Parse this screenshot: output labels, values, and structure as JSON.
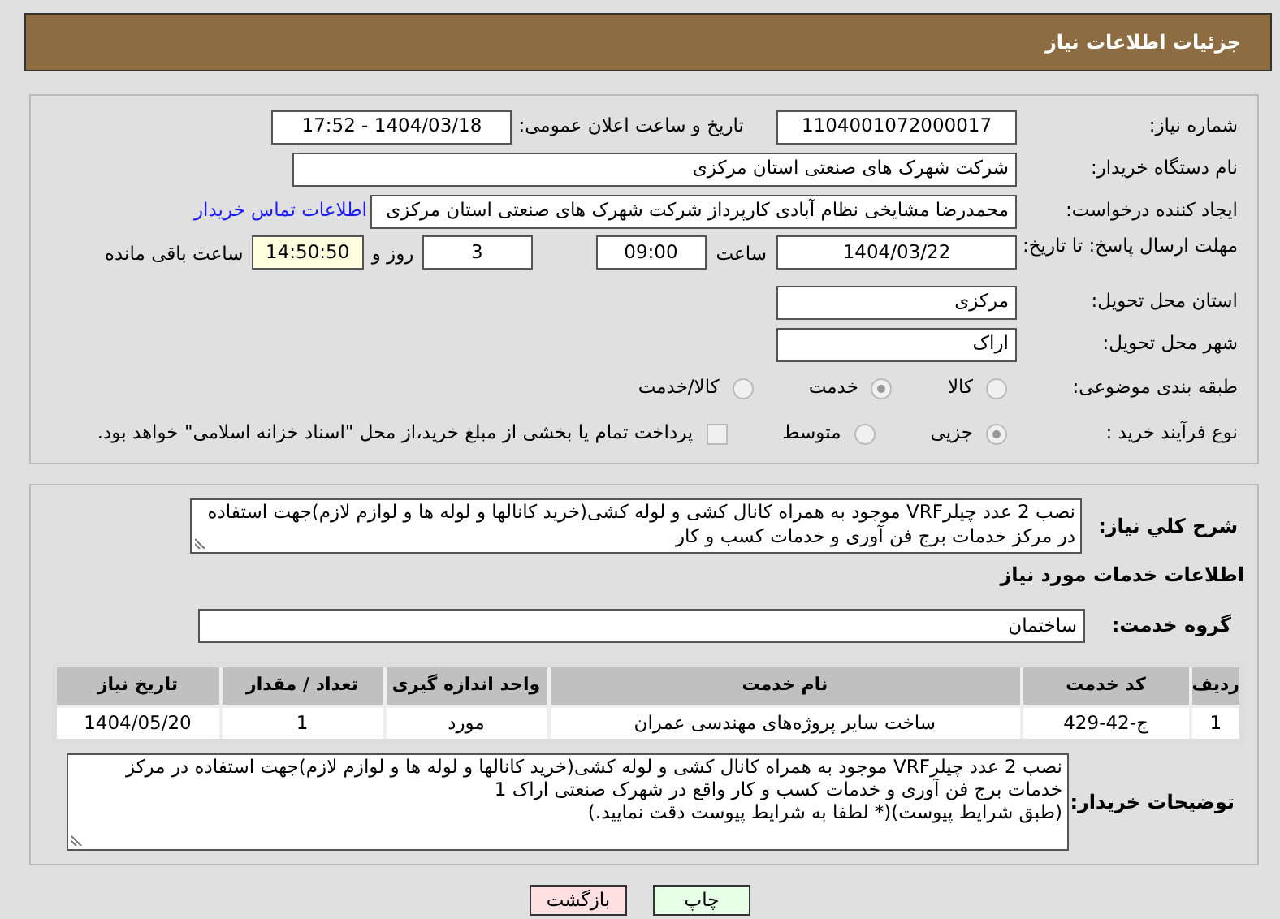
{
  "header": {
    "title": "جزئیات اطلاعات نیاز"
  },
  "need_number": {
    "label": "شماره نیاز:",
    "value": "1104001072000017"
  },
  "announce_datetime": {
    "label": "تاریخ و ساعت اعلان عمومی:",
    "value": "1404/03/18 - 17:52"
  },
  "buyer_org": {
    "label": "نام دستگاه خریدار:",
    "value": "شرکت شهرک های صنعتی استان مرکزی"
  },
  "requester": {
    "label": "ایجاد کننده درخواست:",
    "value": "محمدرضا مشایخی نظام آبادی کارپرداز شرکت شهرک های صنعتی استان مرکزی",
    "link": "اطلاعات تماس خریدار"
  },
  "deadline": {
    "label": "مهلت ارسال پاسخ: تا تاریخ:",
    "date": "1404/03/22",
    "time_label": "ساعت",
    "time": "09:00",
    "days": "3",
    "days_label": "روز و",
    "remaining": "14:50:50",
    "remaining_label": "ساعت باقی مانده"
  },
  "province": {
    "label": "استان محل تحویل:",
    "value": "مرکزی"
  },
  "city": {
    "label": "شهر محل تحویل:",
    "value": "اراک"
  },
  "category": {
    "label": "طبقه بندی موضوعی:",
    "options": [
      {
        "label": "کالا",
        "selected": false
      },
      {
        "label": "خدمت",
        "selected": true
      },
      {
        "label": "کالا/خدمت",
        "selected": false
      }
    ]
  },
  "purchase_type": {
    "label": "نوع فرآیند خرید :",
    "options": [
      {
        "label": "جزیی",
        "selected": true
      },
      {
        "label": "متوسط",
        "selected": false
      }
    ],
    "treasury": {
      "checked": false,
      "text": "پرداخت تمام یا بخشی از مبلغ خرید،از محل \"اسناد خزانه اسلامی\" خواهد بود."
    }
  },
  "summary": {
    "label": "شرح کلي نياز:",
    "value": "نصب 2 عدد چیلرVRF موجود به همراه کانال کشی و لوله کشی(خرید کانالها و لوله ها و لوازم لازم)جهت استفاده در مرکز خدمات برج فن آوری و خدمات کسب و کار"
  },
  "services_heading": "اطلاعات خدمات مورد نیاز",
  "service_group": {
    "label": "گروه خدمت:",
    "value": "ساختمان"
  },
  "table": {
    "columns": [
      "ردیف",
      "کد خدمت",
      "نام خدمت",
      "واحد اندازه گیری",
      "تعداد / مقدار",
      "تاریخ نیاز"
    ],
    "rows": [
      [
        "1",
        "ج-42-429",
        "ساخت سایر پروژه‌های مهندسی عمران",
        "مورد",
        "1",
        "1404/05/20"
      ]
    ]
  },
  "buyer_notes": {
    "label": "توضیحات خریدار:",
    "value": "نصب 2 عدد چیلرVRF موجود به همراه کانال کشی و لوله کشی(خرید کانالها و لوله ها و لوازم لازم)جهت استفاده در مرکز خدمات برج فن آوری و خدمات کسب و کار واقع در شهرک صنعتی اراک 1\n(طبق شرایط پیوست)(* لطفا به شرایط پیوست دقت نمایید.)"
  },
  "buttons": [
    {
      "label": "چاپ",
      "kind": "print"
    },
    {
      "label": "بازگشت",
      "kind": "back"
    }
  ]
}
